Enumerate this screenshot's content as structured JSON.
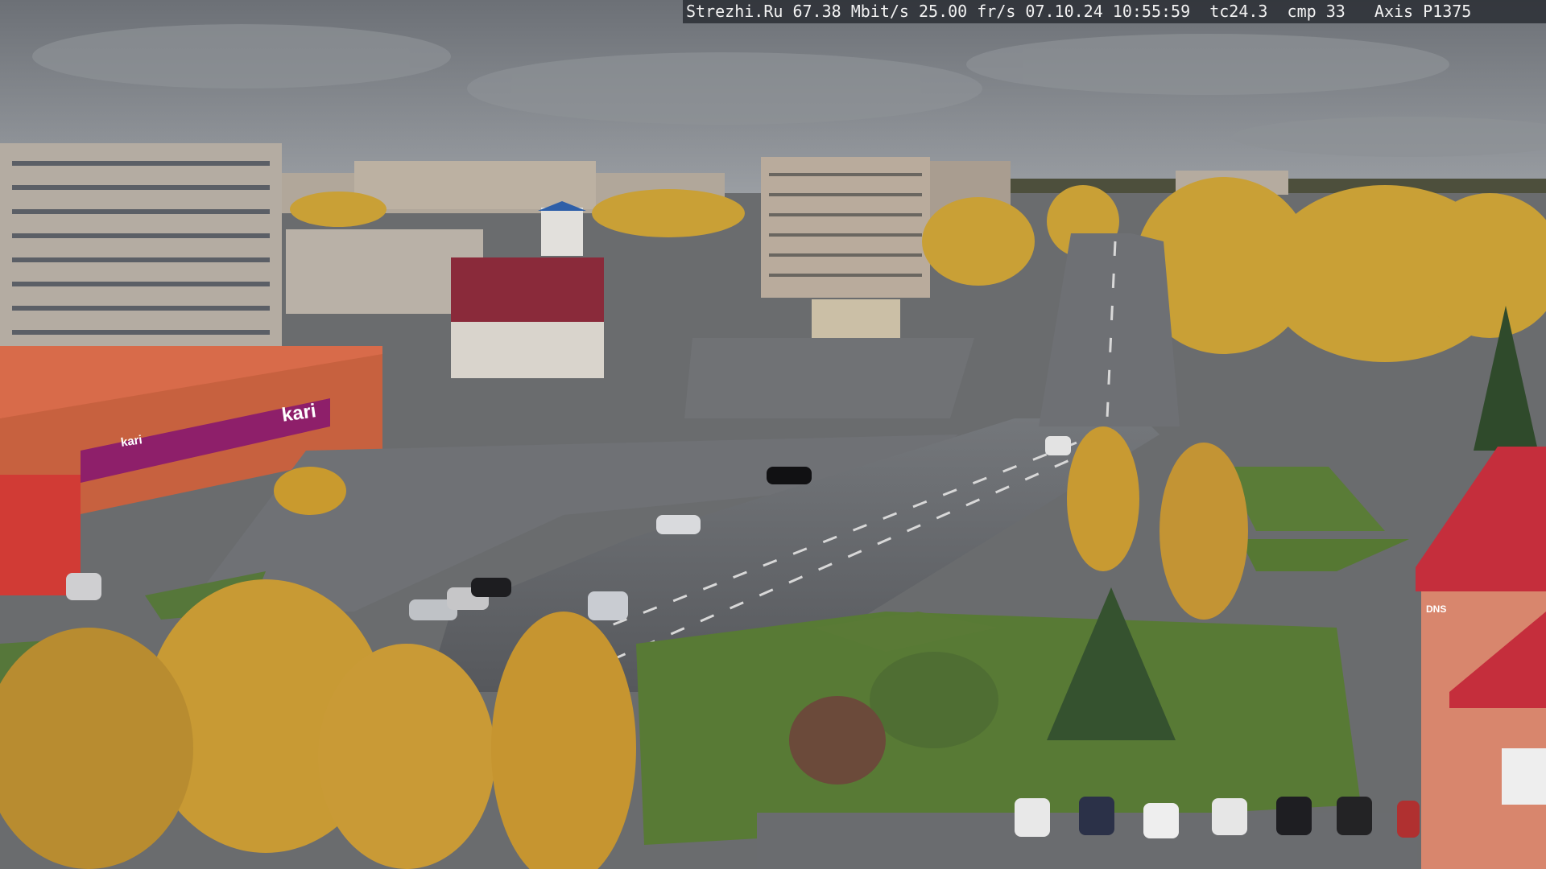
{
  "overlay": {
    "text": "Strezhi.Ru 67.38 Mbit/s 25.00 fr/s 07.10.24 10:55:59  tc24.3  cmp 33   Axis P1375"
  },
  "signs": {
    "kari": "kari",
    "shop": "kari",
    "right": "DNS"
  },
  "colors": {
    "sky": "#7d8187",
    "road": "#5e6064",
    "foliage": "#c79a2b",
    "grass": "#5a7a36",
    "building_red": "#c8372f",
    "kari_magenta": "#8e1f6a"
  }
}
